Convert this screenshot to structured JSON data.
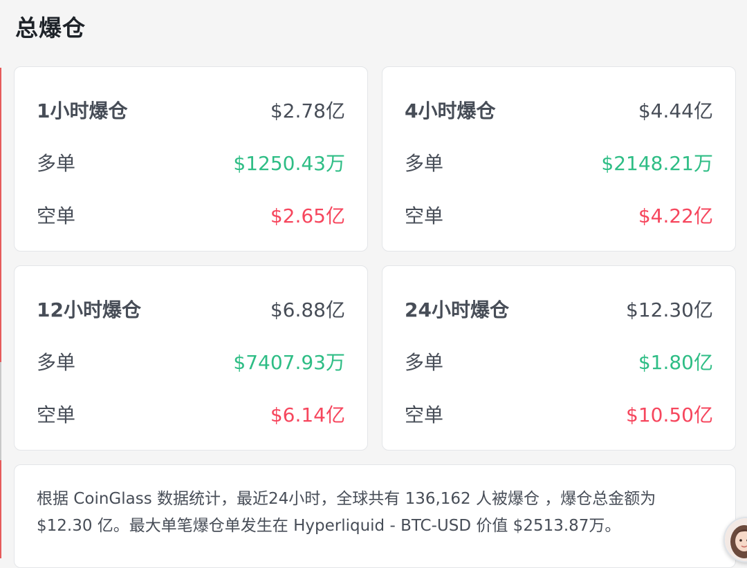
{
  "header": {
    "title": "总爆仓"
  },
  "cards": [
    {
      "title": "1小时爆仓",
      "total": "$2.78亿",
      "long_label": "多单",
      "long_value": "$1250.43万",
      "short_label": "空单",
      "short_value": "$2.65亿"
    },
    {
      "title": "4小时爆仓",
      "total": "$4.44亿",
      "long_label": "多单",
      "long_value": "$2148.21万",
      "short_label": "空单",
      "short_value": "$4.22亿"
    },
    {
      "title": "12小时爆仓",
      "total": "$6.88亿",
      "long_label": "多单",
      "long_value": "$7407.93万",
      "short_label": "空单",
      "short_value": "$6.14亿"
    },
    {
      "title": "24小时爆仓",
      "total": "$12.30亿",
      "long_label": "多单",
      "long_value": "$1.80亿",
      "short_label": "空单",
      "short_value": "$10.50亿"
    }
  ],
  "summary": {
    "line1": "根据 CoinGlass 数据统计，最近24小时，全球共有 136,162 人被爆仓 ，爆仓总金额为",
    "line2": "$12.30 亿。最大单笔爆仓单发生在 Hyperliquid - BTC-USD 价值 $2513.87万。"
  },
  "colors": {
    "long": "#2ebd85",
    "short": "#f6465d",
    "text": "#474d57",
    "background": "#f5f5f5"
  },
  "icons": {
    "avatar": "assistant-avatar-icon"
  }
}
